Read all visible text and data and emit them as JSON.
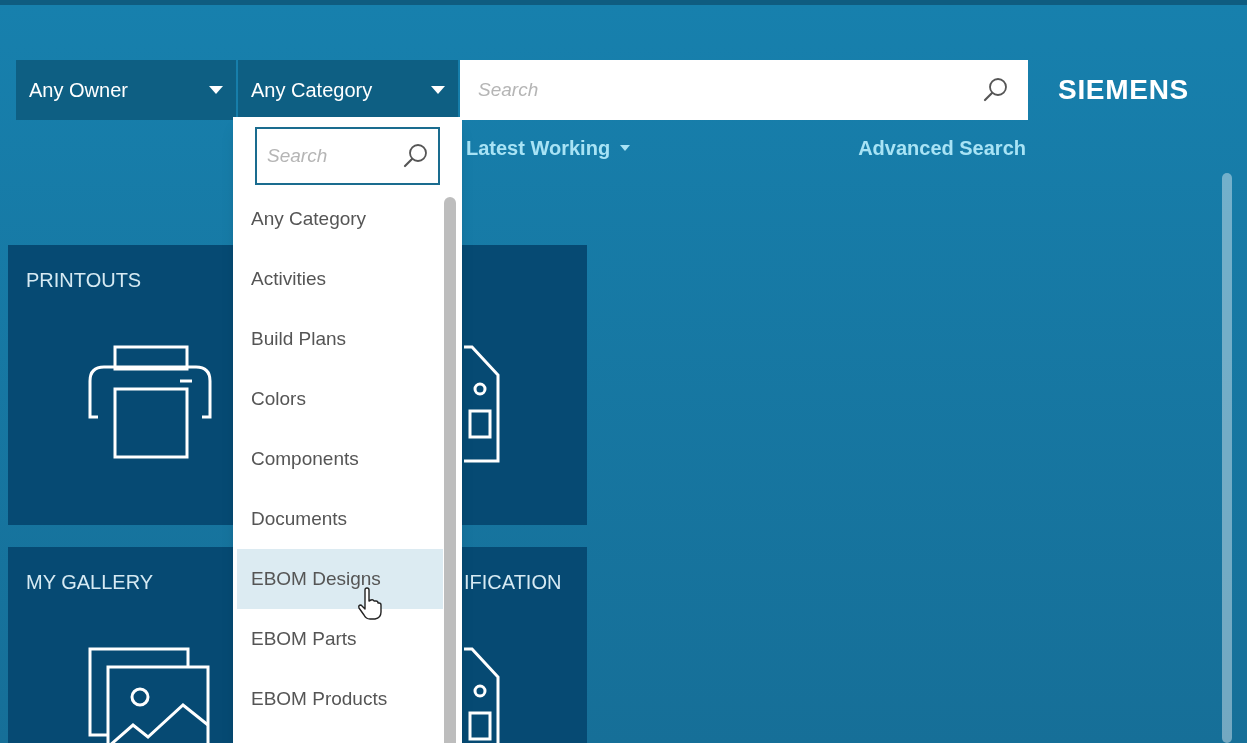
{
  "filters": [
    {
      "label": "Any Owner"
    },
    {
      "label": "Any Category"
    }
  ],
  "search": {
    "placeholder": "Search"
  },
  "brand": "SIEMENS",
  "revision_rule": "Latest Working",
  "advanced_search": "Advanced Search",
  "tiles": [
    {
      "kind": "printer",
      "title": "PRINTOUTS"
    },
    {
      "kind": "document"
    },
    {
      "kind": "gallery",
      "title": "MY GALLERY"
    },
    {
      "kind": "document",
      "title": "IFICATION"
    }
  ],
  "category_menu": {
    "search_placeholder": "Search",
    "items": [
      {
        "label": "Any Category",
        "highlighted": false
      },
      {
        "label": "Activities",
        "highlighted": false
      },
      {
        "label": "Build Plans",
        "highlighted": false
      },
      {
        "label": "Colors",
        "highlighted": false
      },
      {
        "label": "Components",
        "highlighted": false
      },
      {
        "label": "Documents",
        "highlighted": false
      },
      {
        "label": "EBOM Designs",
        "highlighted": true
      },
      {
        "label": "EBOM Parts",
        "highlighted": false
      },
      {
        "label": "EBOM Products",
        "highlighted": false
      }
    ]
  }
}
